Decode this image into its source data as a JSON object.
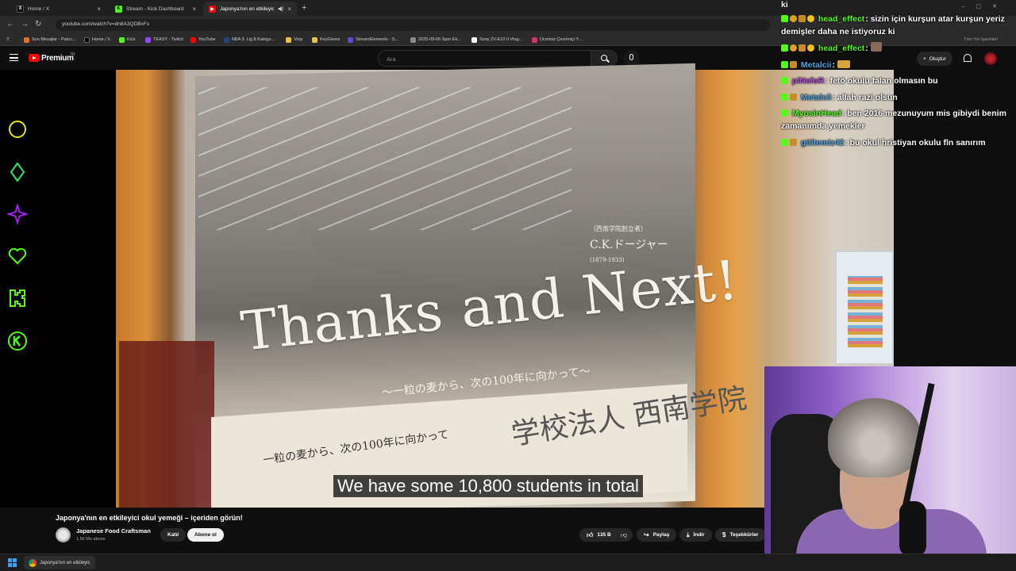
{
  "browser": {
    "tabs": [
      {
        "label": "Home / X",
        "icon": "x-icon"
      },
      {
        "label": "Stream - Kick Dashboard",
        "icon": "kick-icon"
      },
      {
        "label": "Japonya'nın en etkileyici o...",
        "icon": "youtube-icon",
        "active": true
      }
    ],
    "url": "youtube.com/watch?v=dn8A3QDBxFs",
    "bookmarks": [
      "Son Mesajlar - Patıcı...",
      "Home / X",
      "Kick",
      "TEASY - Twitch",
      "YouTube",
      "NBA 3. Lig 8 Katego...",
      "Vorp",
      "KeyGivers",
      "StreamElements - S...",
      "2025-09-06 Spor Ek...",
      "Sony ZV-E10 II Vlog...",
      "Ücretsiz Çevrimiçi Y...",
      "Tüm Yer İşaretleri"
    ]
  },
  "youtube": {
    "logo_text": "Premium",
    "region": "TR",
    "search_placeholder": "Ara",
    "create_label": "Oluştur"
  },
  "video": {
    "subtitle": "We have some 10,800 students in total",
    "poster": {
      "title": "Thanks and Next!",
      "subtitle_jp": "〜一粒の麦から、次の100年に向かって〜",
      "founder_tag": "（西南学院創立者）",
      "founder_name": "C.K.ドージャー",
      "founder_years": "(1879-1933)",
      "bottom_jp": "一粒の麦から、次の100年に向かって",
      "school": "学校法人 西南学院"
    }
  },
  "info": {
    "title": "Japonya'nın en etkileyici okul yemeği – içeriden görün!",
    "channel": "Japanese Food Craftsman",
    "subs": "1,56 Mn abone",
    "join": "Katıl",
    "subscribe": "Abone ol",
    "likes": "135 B",
    "share": "Paylaş",
    "download": "İndir",
    "thanks": "Teşekkürler"
  },
  "chat": [
    {
      "user": "",
      "text": "ki",
      "color": "#ffffff"
    },
    {
      "user": "head_effect",
      "text": "sizin için kurşun atar kurşun yeriz demişler daha ne istiyoruz ki",
      "color": "#53fc18"
    },
    {
      "user": "head_effect",
      "text": "",
      "color": "#53fc18"
    },
    {
      "user": "Metalcii",
      "text": "",
      "color": "#4fa3e0"
    },
    {
      "user": "piNefoR",
      "text": "fetö okulu falan olmasın bu",
      "color": "#b04fe0"
    },
    {
      "user": "Metalcii",
      "text": "allah razi olsun",
      "color": "#4fa3e0"
    },
    {
      "user": "MyosinHead",
      "text": "ben 2016 mezunuyum mis gibiydi benim zamanımda yemekler",
      "color": "#53fc18"
    },
    {
      "user": "gültemiz42",
      "text": "bu okul hristiyan okulu fln sanırım",
      "color": "#4fa3e0"
    }
  ],
  "taskbar": {
    "item": "Japonya'nın en etkileyic"
  },
  "colors": {
    "kick_green": "#53fc18",
    "youtube_red": "#ff0000",
    "overlay_yellow": "#e6e61e",
    "overlay_purple": "#a020f0"
  }
}
